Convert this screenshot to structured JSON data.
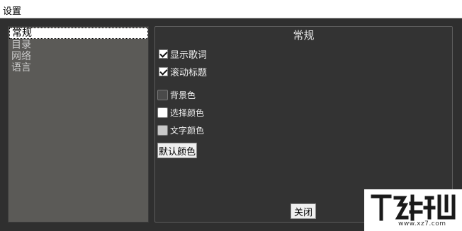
{
  "window": {
    "title": "设置"
  },
  "sidebar": {
    "items": [
      {
        "label": "常规",
        "selected": true
      },
      {
        "label": "目录"
      },
      {
        "label": "网络"
      },
      {
        "label": "语言"
      }
    ]
  },
  "panel": {
    "title": "常规",
    "options": [
      {
        "label": "显示歌词",
        "checked": true
      },
      {
        "label": "滚动标题",
        "checked": true
      }
    ],
    "colors": [
      {
        "label": "背景色",
        "color": "#4a4a4a"
      },
      {
        "label": "选择颜色",
        "color": "#ffffff"
      },
      {
        "label": "文字颜色",
        "color": "#c8c8c8"
      }
    ],
    "default_color_button": "默认颜色",
    "close_button": "关闭"
  },
  "watermark": {
    "text": "www.xz7.com"
  }
}
